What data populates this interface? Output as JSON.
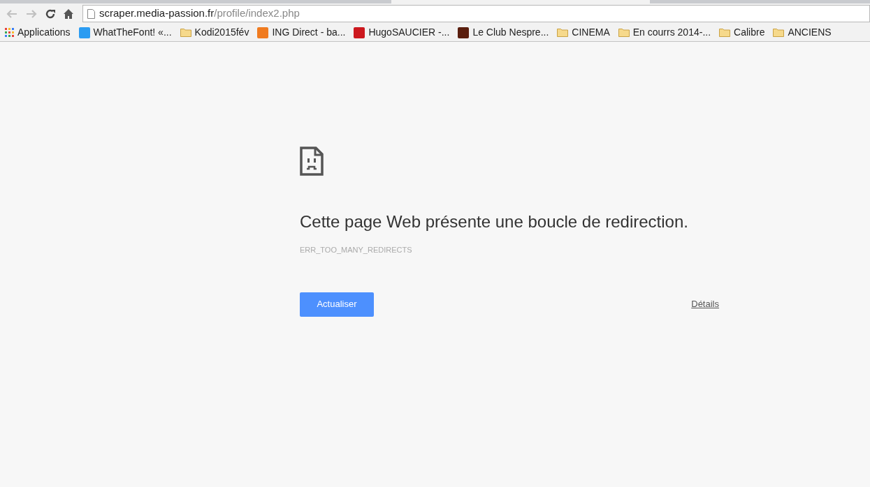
{
  "address_bar": {
    "host": "scraper.media-passion.fr",
    "path": "/profile/index2.php"
  },
  "bookmarks": [
    {
      "kind": "apps",
      "label": "Applications"
    },
    {
      "kind": "site",
      "label": "WhatTheFont! «...",
      "color": "#2b9cf2"
    },
    {
      "kind": "folder",
      "label": "Kodi2015fév"
    },
    {
      "kind": "site",
      "label": "ING Direct - ba...",
      "color": "#f07b20"
    },
    {
      "kind": "site",
      "label": "HugoSAUCIER -...",
      "color": "#cc181e"
    },
    {
      "kind": "site",
      "label": "Le Club Nespre...",
      "color": "#5a1e0e"
    },
    {
      "kind": "folder",
      "label": "CINEMA"
    },
    {
      "kind": "folder",
      "label": "En courrs 2014-..."
    },
    {
      "kind": "folder",
      "label": "Calibre"
    },
    {
      "kind": "folder",
      "label": "ANCIENS"
    }
  ],
  "error": {
    "title": "Cette page Web présente une boucle de redirection.",
    "code": "ERR_TOO_MANY_REDIRECTS",
    "reload_button": "Actualiser",
    "details_link": "Détails"
  }
}
